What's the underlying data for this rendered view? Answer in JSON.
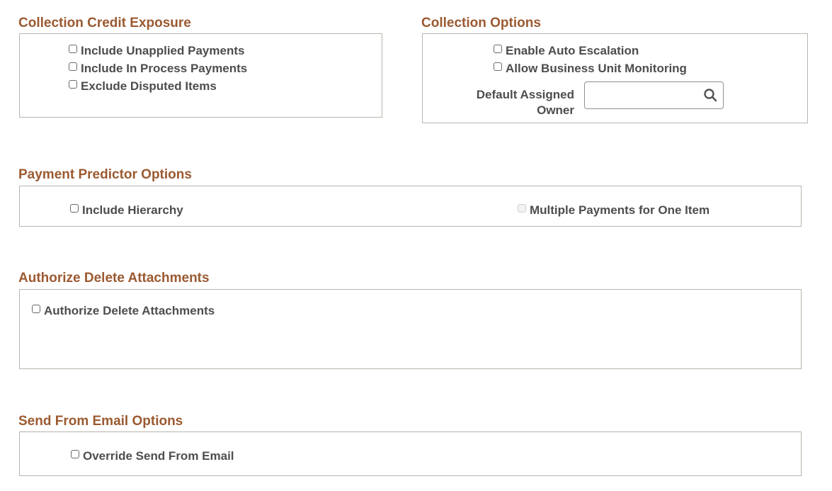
{
  "sections": {
    "credit_exposure": {
      "title": "Collection Credit Exposure",
      "options": [
        {
          "label": "Include Unapplied Payments",
          "checked": false
        },
        {
          "label": "Include In Process Payments",
          "checked": false
        },
        {
          "label": "Exclude Disputed Items",
          "checked": false
        }
      ]
    },
    "collection_options": {
      "title": "Collection Options",
      "options": [
        {
          "label": "Enable Auto Escalation",
          "checked": false
        },
        {
          "label": "Allow Business Unit Monitoring",
          "checked": false
        }
      ],
      "owner_field": {
        "label_line1": "Default Assigned",
        "label_line2": "Owner",
        "value": "",
        "icon": "search-icon"
      }
    },
    "payment_predictor": {
      "title": "Payment Predictor Options",
      "options": [
        {
          "label": "Include Hierarchy",
          "checked": false,
          "disabled": false
        },
        {
          "label": "Multiple Payments for One Item",
          "checked": false,
          "disabled": true
        }
      ]
    },
    "authorize_delete": {
      "title": "Authorize Delete Attachments",
      "options": [
        {
          "label": "Authorize Delete Attachments",
          "checked": false
        }
      ]
    },
    "send_from_email": {
      "title": "Send From Email Options",
      "options": [
        {
          "label": "Override Send From Email",
          "checked": false
        }
      ]
    }
  },
  "colors": {
    "section_title": "#9b5a31",
    "label_text": "#4d4d4d",
    "box_border": "#bab4ad"
  }
}
